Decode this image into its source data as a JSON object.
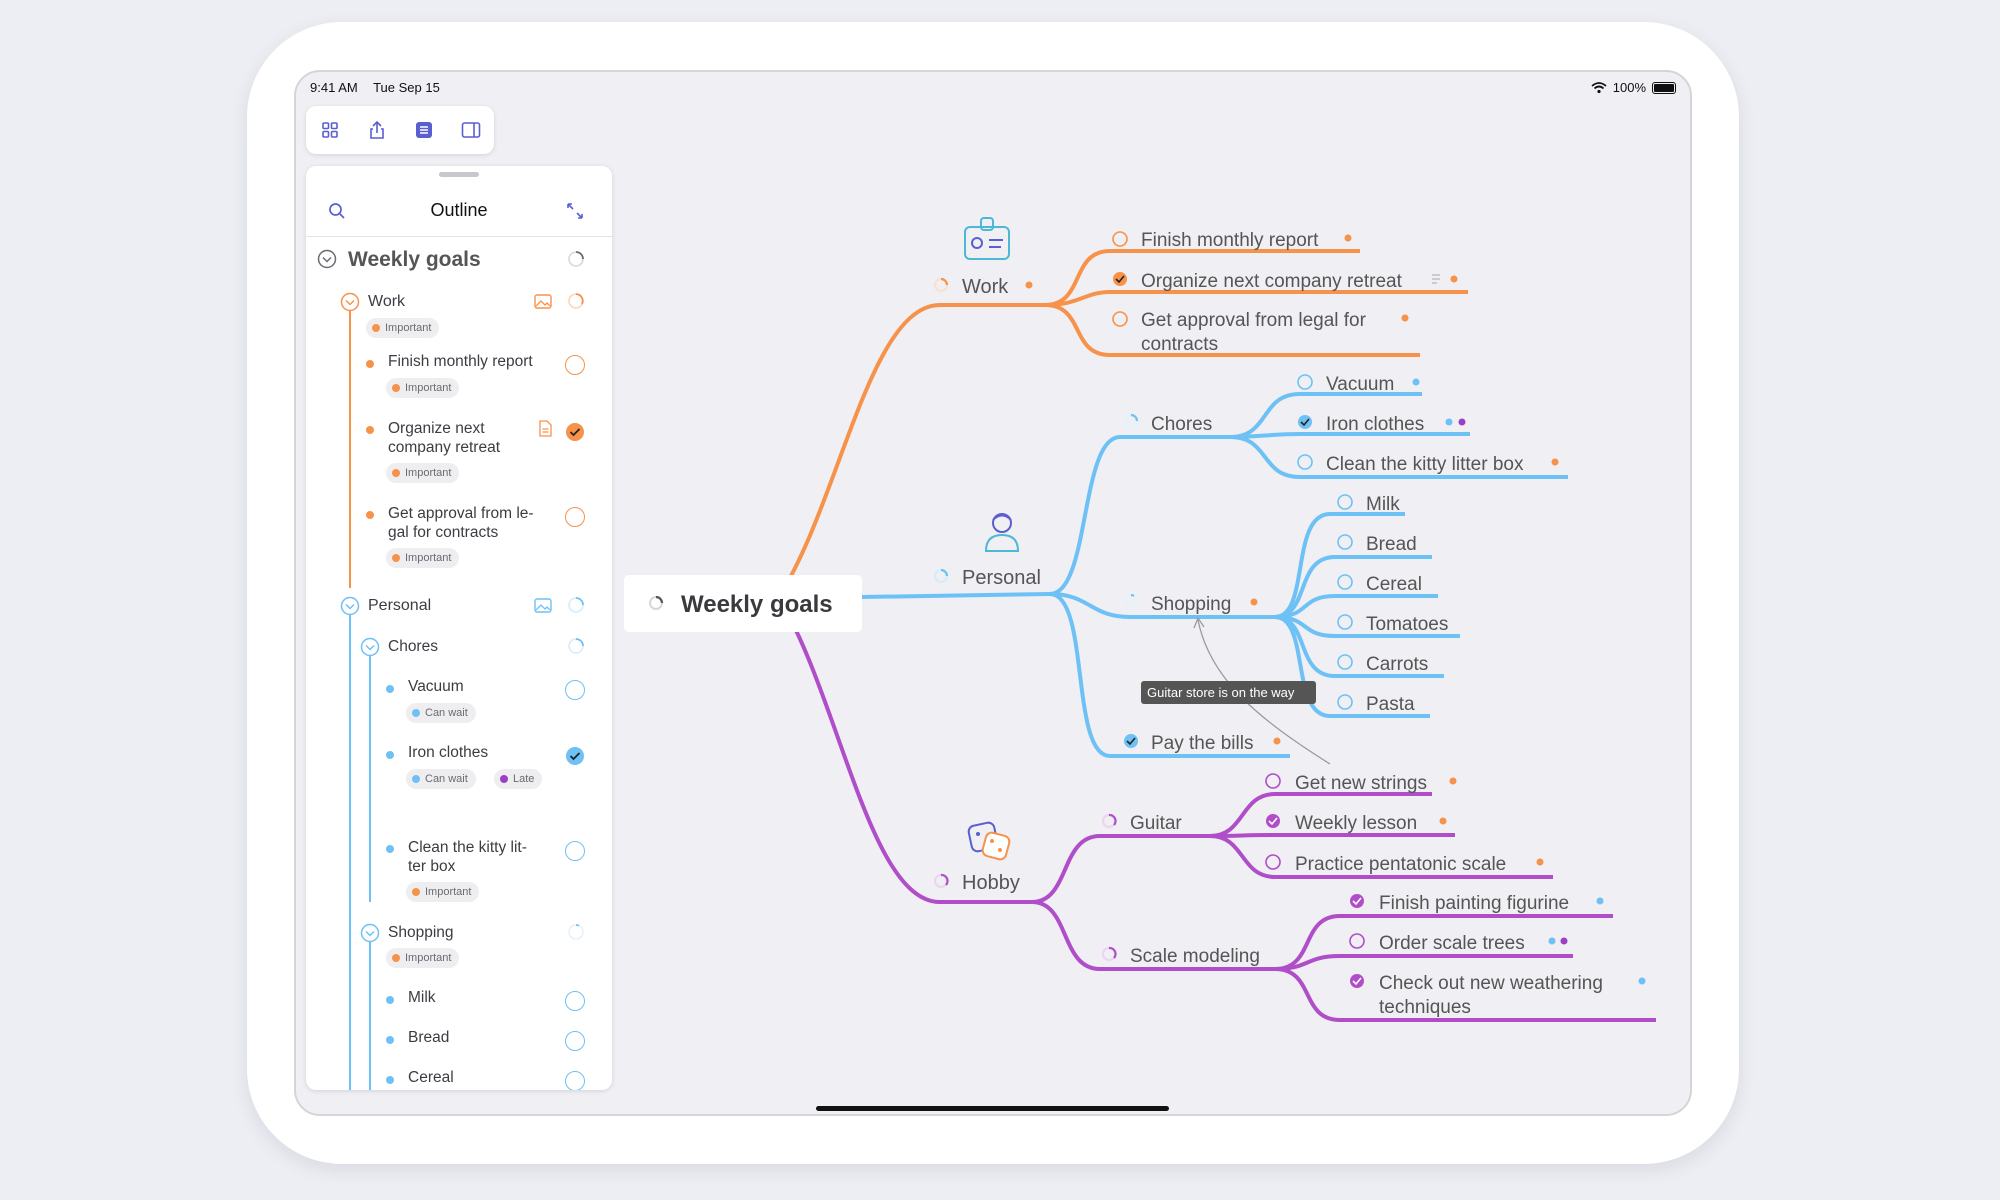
{
  "status_bar": {
    "time": "9:41 AM",
    "date": "Tue Sep 15",
    "battery": "100%"
  },
  "toolbar": {
    "icons": [
      "grid-icon",
      "share-icon",
      "outline-icon",
      "sidebar-icon"
    ]
  },
  "outline": {
    "title": "Outline",
    "root": "Weekly goals",
    "items": [
      {
        "label": "Work",
        "tag": "Important"
      },
      {
        "label": "Finish monthly report",
        "tag": "Important"
      },
      {
        "label_line1": "Organize next",
        "label_line2": "company retreat",
        "tag": "Important"
      },
      {
        "label_line1": "Get approval from le-",
        "label_line2": "gal for contracts",
        "tag": "Important"
      },
      {
        "label": "Personal"
      },
      {
        "label": "Chores"
      },
      {
        "label": "Vacuum",
        "tag": "Can wait"
      },
      {
        "label": "Iron clothes",
        "tag": "Can wait",
        "tag2": "Late"
      },
      {
        "label_line1": "Clean the kitty lit-",
        "label_line2": "ter box",
        "tag": "Important"
      },
      {
        "label": "Shopping",
        "tag": "Important"
      },
      {
        "label": "Milk"
      },
      {
        "label": "Bread"
      },
      {
        "label": "Cereal"
      }
    ]
  },
  "mindmap": {
    "root": "Weekly goals",
    "branches": [
      {
        "label": "Work",
        "color": "#f7924a",
        "children": [
          "Finish monthly report",
          "Organize next company retreat",
          "Get approval from legal for",
          "contracts"
        ]
      },
      {
        "label": "Personal",
        "color": "#6ec1f5",
        "children": [
          "Chores",
          "Shopping",
          "Pay the bills"
        ]
      },
      {
        "label": "Hobby",
        "color": "#b04dc8",
        "children": [
          "Guitar",
          "Scale modeling"
        ]
      }
    ],
    "chores": [
      "Vacuum",
      "Iron clothes",
      "Clean the kitty litter box"
    ],
    "shopping": [
      "Milk",
      "Bread",
      "Cereal",
      "Tomatoes",
      "Carrots",
      "Pasta"
    ],
    "guitar": [
      "Get new strings",
      "Weekly lesson",
      "Practice pentatonic scale"
    ],
    "scale_modeling": [
      "Finish painting figurine",
      "Order scale trees",
      "Check out new weathering",
      "techniques"
    ],
    "tooltip": "Guitar store is on the way"
  },
  "colors": {
    "work": "#f7924a",
    "personal": "#6ec1f5",
    "hobby": "#b04dc8",
    "late": "#9b3fc4"
  }
}
